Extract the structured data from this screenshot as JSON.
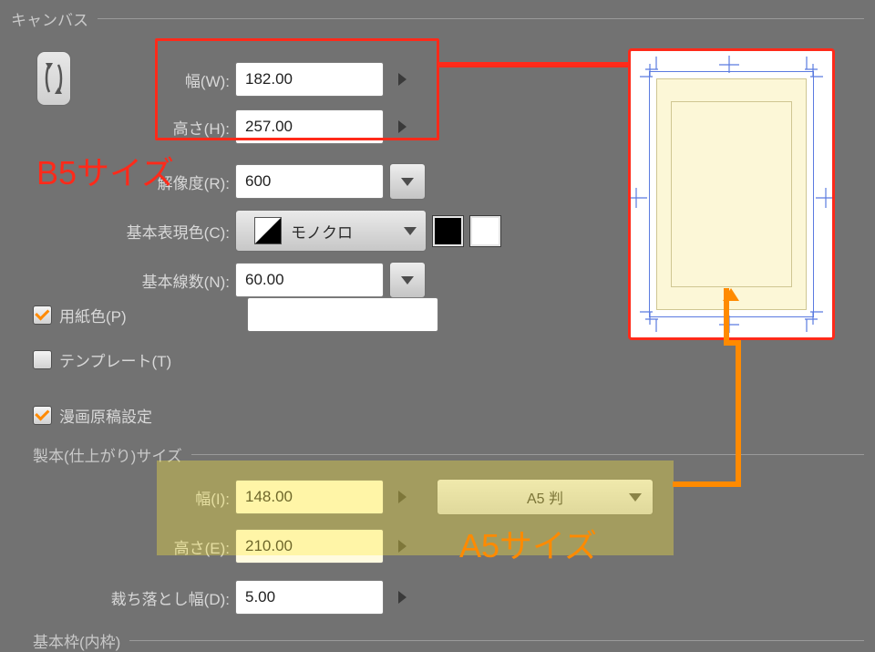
{
  "canvas": {
    "legend": "キャンバス",
    "width_label": "幅(W):",
    "height_label": "高さ(H):",
    "resolution_label": "解像度(R):",
    "color_mode_label": "基本表現色(C):",
    "screen_freq_label": "基本線数(N):",
    "width": "182.00",
    "height": "257.00",
    "resolution": "600",
    "color_mode": "モノクロ",
    "screen_freq": "60.00",
    "paper_color_label": "用紙色(P)",
    "template_label": "テンプレート(T)"
  },
  "manga": {
    "checkbox_label": "漫画原稿設定",
    "binding_legend": "製本(仕上がり)サイズ",
    "width_label": "幅(I):",
    "height_label": "高さ(E):",
    "width": "148.00",
    "height": "210.00",
    "preset": "A5 判",
    "bleed_label": "裁ち落とし幅(D):",
    "bleed": "5.00",
    "inner_frame_legend": "基本枠(内枠)"
  },
  "annotations": {
    "b5_label": "B5サイズ",
    "a5_label": "A5サイズ"
  }
}
